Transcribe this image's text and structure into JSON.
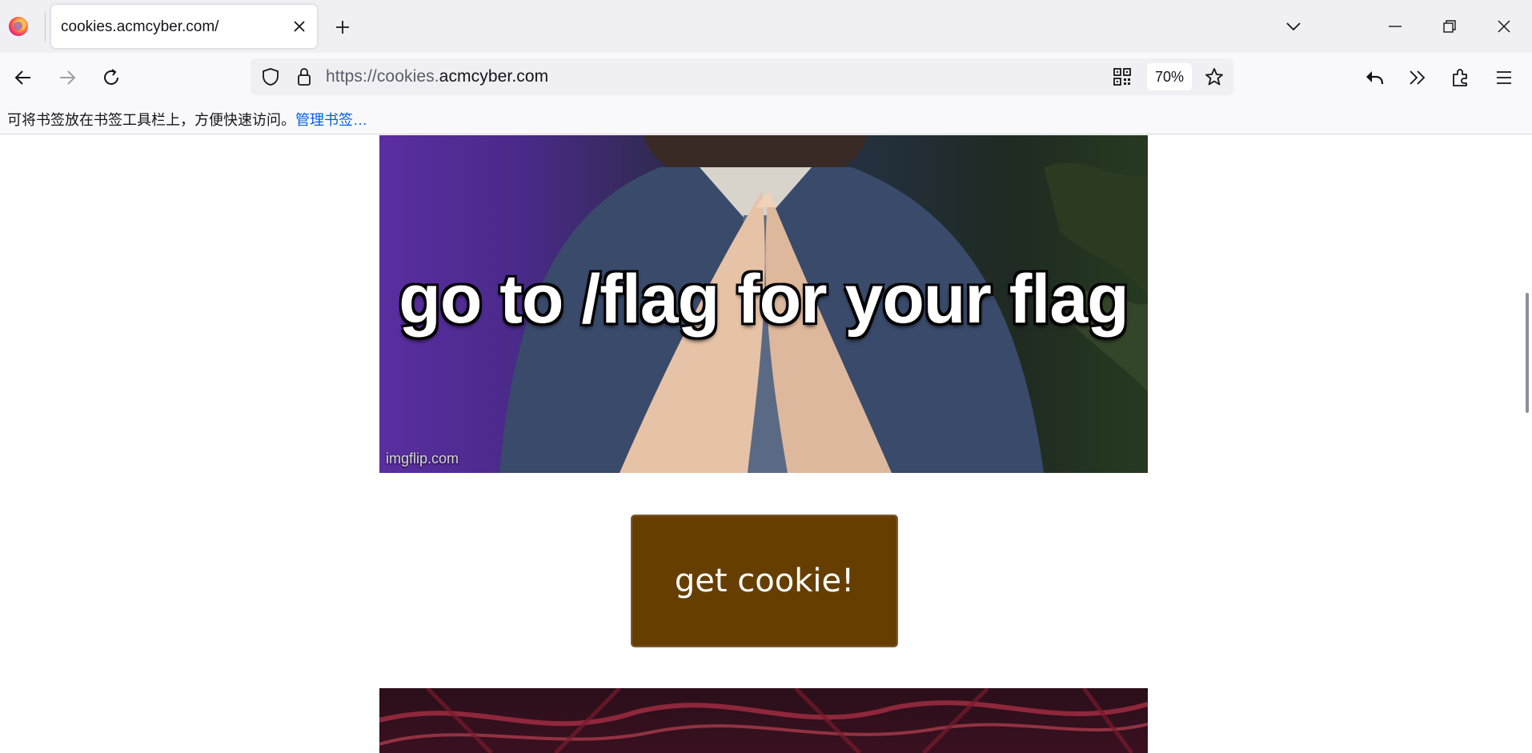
{
  "browser": {
    "tab": {
      "title": "cookies.acmcyber.com/"
    },
    "url": {
      "prefix": "https://cookies.",
      "host": "acmcyber.com"
    },
    "zoom": "70%",
    "bookmarks_hint": {
      "text": "可将书签放在书签工具栏上，方便快速访问。",
      "link": "管理书签…"
    }
  },
  "page": {
    "meme": {
      "caption": "go to /flag for your flag",
      "watermark": "imgflip.com"
    },
    "cookie_button": {
      "label": "get cookie!",
      "color": "#663f00"
    }
  },
  "icons": [
    "firefox-logo-icon",
    "close-icon",
    "plus-icon",
    "chevron-down-icon",
    "minimize-icon",
    "restore-icon",
    "back-arrow-icon",
    "forward-arrow-icon",
    "reload-icon",
    "shield-icon",
    "lock-icon",
    "qr-code-icon",
    "star-icon",
    "undo-icon",
    "chevron-double-right-icon",
    "extensions-icon",
    "hamburger-menu-icon"
  ]
}
